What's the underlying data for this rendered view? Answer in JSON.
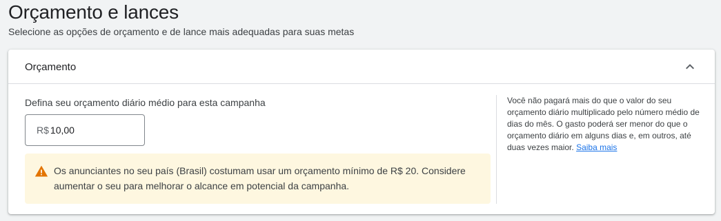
{
  "page": {
    "title": "Orçamento e lances",
    "subtitle": "Selecione as opções de orçamento e de lance mais adequadas para suas metas"
  },
  "budget_section": {
    "header_title": "Orçamento",
    "collapse_icon": "chevron-up-icon",
    "field_label": "Defina seu orçamento diário médio para esta campanha",
    "currency_prefix": "R$",
    "budget_value": "10,00",
    "warning": {
      "icon": "warning-triangle-icon",
      "icon_color": "#e37400",
      "background_color": "#fef7e0",
      "text": "Os anunciantes no seu país (Brasil) costumam usar um orçamento mínimo de R$ 20. Considere aumentar o seu para melhorar o alcance em potencial da campanha."
    },
    "help": {
      "text": "Você não pagará mais do que o valor do seu orçamento diário multiplicado pelo número médio de dias do mês. O gasto poderá ser menor do que o orçamento diário em alguns dias e, em outros, até duas vezes maior.",
      "link_label": "Saiba mais",
      "link_color": "#1a73e8"
    }
  }
}
